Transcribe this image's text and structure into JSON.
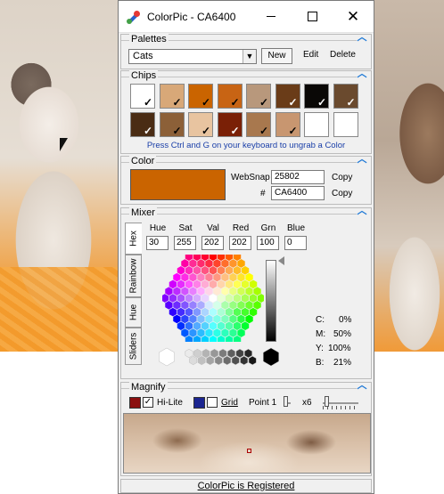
{
  "window": {
    "title": "ColorPic - CA6400"
  },
  "palettes": {
    "section_title": "Palettes",
    "selected": "Cats",
    "new_label": "New",
    "edit_label": "Edit",
    "delete_label": "Delete"
  },
  "chips": {
    "section_title": "Chips",
    "hint": "Press Ctrl and G on your keyboard to ungrab a Color",
    "colors": [
      "#ffffff",
      "#d8a878",
      "#ca6400",
      "#c86414",
      "#b8987c",
      "#6a3c18",
      "#0a0806",
      "#6a4a2e",
      "#4a2c14",
      "#8c6038",
      "#e8c4a0",
      "#7a2006",
      "#a8784e",
      "#c89670",
      "#ffffff",
      "#ffffff"
    ],
    "checked": [
      true,
      true,
      true,
      true,
      true,
      true,
      true,
      true,
      true,
      true,
      true,
      true,
      true,
      true,
      false,
      false
    ]
  },
  "color": {
    "section_title": "Color",
    "swatch": "#ca6400",
    "websnap_label": "WebSnap",
    "websnap_value": "25802",
    "hash_label": "#",
    "hex_value": "CA6400",
    "copy_label": "Copy"
  },
  "mixer": {
    "section_title": "Mixer",
    "tabs": [
      "Hex",
      "Rainbow",
      "Hue",
      "Sliders"
    ],
    "labels": [
      "Hue",
      "Sat",
      "Val",
      "Red",
      "Grn",
      "Blue"
    ],
    "values": [
      "30",
      "255",
      "202",
      "202",
      "100",
      "0"
    ],
    "cmyk": {
      "c": "C:",
      "c_val": "0%",
      "m": "M:",
      "m_val": "50%",
      "y": "Y:",
      "y_val": "100%",
      "k": "B:",
      "k_val": "21%"
    }
  },
  "magnify": {
    "section_title": "Magnify",
    "hilite_label": "Hi-Lite",
    "hilite_color": "#8b0f0f",
    "grid_label": "Grid",
    "grid_color": "#1b2590",
    "point_label": "Point 1",
    "zoom_label": "x6"
  },
  "status": {
    "text": "ColorPic is Registered"
  }
}
